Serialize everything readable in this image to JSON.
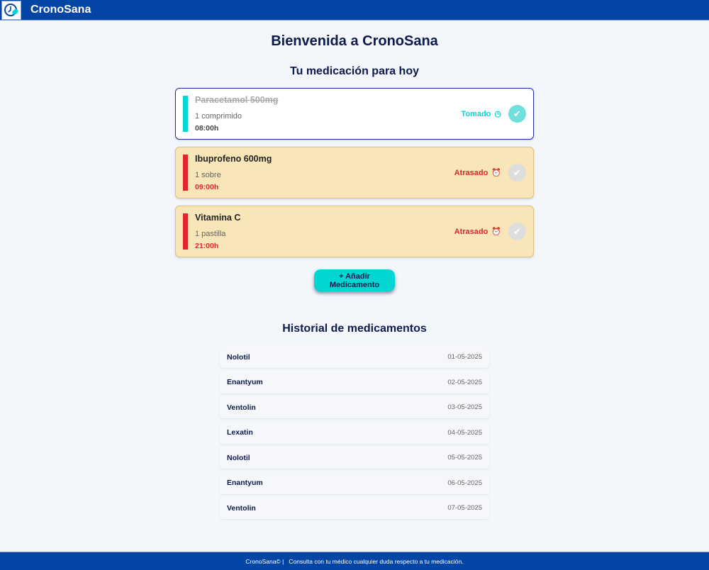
{
  "app": {
    "name": "CronoSana"
  },
  "main": {
    "title": "Bienvenida a CronoSana",
    "today_heading": "Tu medicación para hoy",
    "add_button": "+ Añadir Medicamento",
    "history_heading": "Historial de medicamentos"
  },
  "medications": [
    {
      "name": "Paracetamol 500mg",
      "dose": "1 comprimido",
      "time": "08:00h",
      "status": "Tomado"
    },
    {
      "name": "Ibuprofeno 600mg",
      "dose": "1 sobre",
      "time": "09:00h",
      "status": "Atrasado"
    },
    {
      "name": "Vitamina C",
      "dose": "1 pastilla",
      "time": "21:00h",
      "status": "Atrasado"
    }
  ],
  "history": [
    {
      "name": "Nolotil",
      "date": "01-05-2025"
    },
    {
      "name": "Enantyum",
      "date": "02-05-2025"
    },
    {
      "name": "Ventolin",
      "date": "03-05-2025"
    },
    {
      "name": "Lexatin",
      "date": "04-05-2025"
    },
    {
      "name": "Nolotil",
      "date": "05-05-2025"
    },
    {
      "name": "Enantyum",
      "date": "06-05-2025"
    },
    {
      "name": "Ventolin",
      "date": "07-05-2025"
    }
  ],
  "footer": {
    "brand": "CronoSana©",
    "separator": "|",
    "text": "Consulta con tu médico cualquier duda respecto a tu medicación."
  },
  "colors": {
    "primary": "#0345a5",
    "taken": "#00d7d3",
    "late": "#e1262d"
  }
}
